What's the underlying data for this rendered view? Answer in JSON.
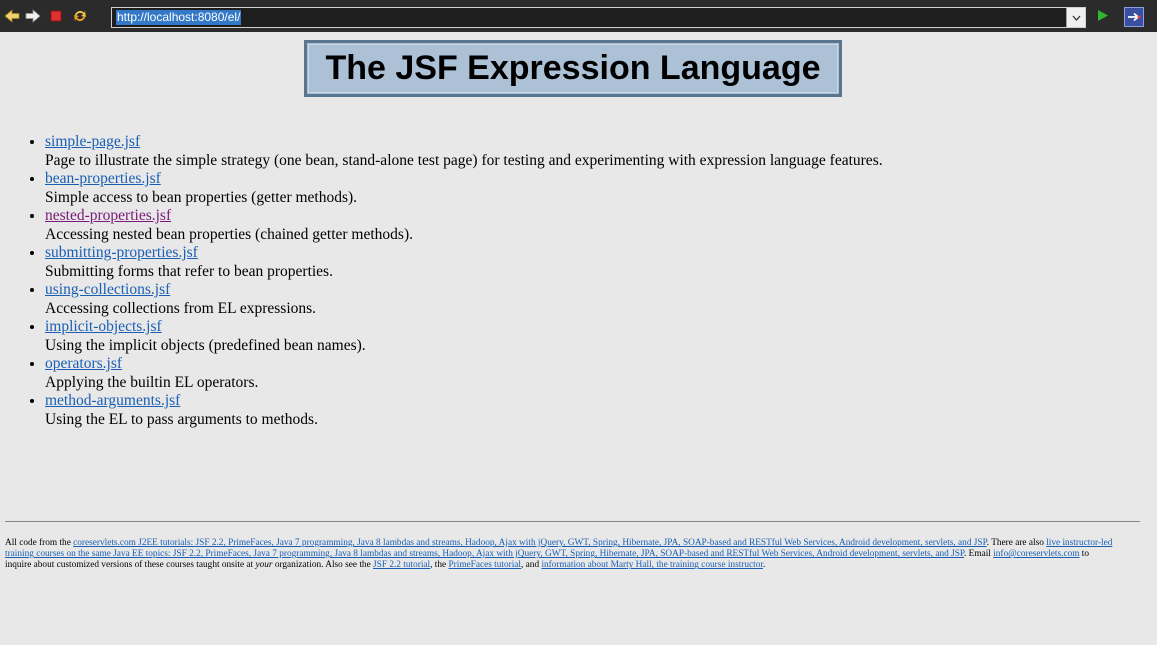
{
  "browser": {
    "url": "http://localhost:8080/el/"
  },
  "page": {
    "title": "The JSF Expression Language",
    "items": [
      {
        "link": "simple-page.jsf",
        "desc": "Page to illustrate the simple strategy (one bean, stand-alone test page) for testing and experimenting with expression language features.",
        "visited": false
      },
      {
        "link": "bean-properties.jsf",
        "desc": "Simple access to bean properties (getter methods).",
        "visited": false
      },
      {
        "link": "nested-properties.jsf",
        "desc": "Accessing nested bean properties (chained getter methods).",
        "visited": true
      },
      {
        "link": "submitting-properties.jsf",
        "desc": "Submitting forms that refer to bean properties.",
        "visited": false
      },
      {
        "link": "using-collections.jsf",
        "desc": "Accessing collections from EL expressions.",
        "visited": false
      },
      {
        "link": "implicit-objects.jsf",
        "desc": "Using the implicit objects (predefined bean names).",
        "visited": false
      },
      {
        "link": "operators.jsf",
        "desc": "Applying the builtin EL operators.",
        "visited": false
      },
      {
        "link": "method-arguments.jsf",
        "desc": "Using the EL to pass arguments to methods.",
        "visited": false
      }
    ]
  },
  "footer": {
    "t1": "All code from the ",
    "l1": "coreservlets.com J2EE tutorials: JSF 2.2, PrimeFaces, Java 7 programming, Java 8 lambdas and streams, Hadoop, Ajax with jQuery, GWT, Spring, Hibernate, JPA, SOAP-based and RESTful Web Services, Android development, servlets, and JSP",
    "t2": ". There are also ",
    "l2": "live instructor-led training courses on the same Java EE topics: JSF 2.2, PrimeFaces, Java 7 programming, Java 8 lambdas and streams, Hadoop, Ajax with jQuery, GWT, Spring, Hibernate, JPA, SOAP-based and RESTful Web Services, Android development, servlets, and JSP",
    "t3": ". Email ",
    "l3": "info@coreservlets.com",
    "t4": " to inquire about customized versions of these courses taught onsite at ",
    "t4i": "your",
    "t5": " organization. Also see the ",
    "l4": "JSF 2.2 tutorial",
    "t6": ", the ",
    "l5": "PrimeFaces tutorial",
    "t7": ", and ",
    "l6": "information about Marty Hall, the training course instructor",
    "t8": "."
  }
}
